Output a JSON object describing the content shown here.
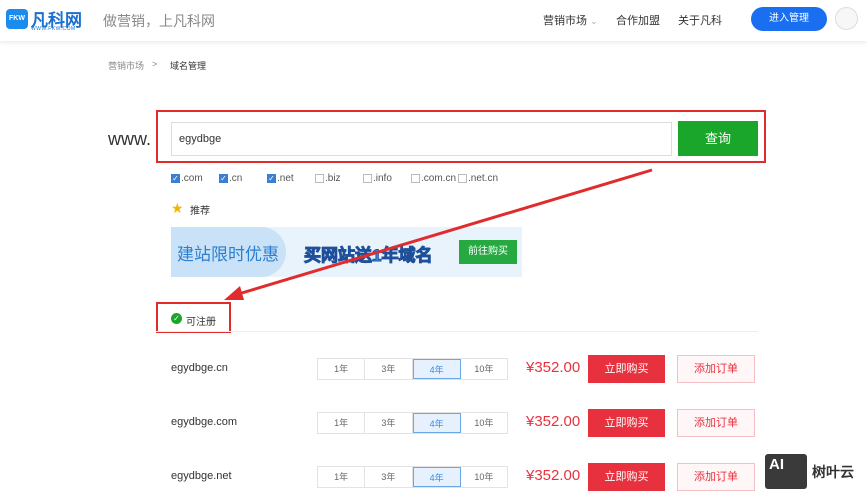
{
  "header": {
    "logo_badge": "FKW",
    "logo_name": "凡科网",
    "logo_url": "WWW.FKW.COM",
    "slogan": "做营销，上凡科网",
    "nav": [
      "营销市场",
      "合作加盟",
      "关于凡科"
    ],
    "nav_dropdown": "⌄",
    "enter_button": "进入管理"
  },
  "breadcrumb": {
    "parent": "营销市场",
    "sep": ">",
    "current": "域名管理"
  },
  "search": {
    "prefix": "www.",
    "value": "egydbge",
    "button": "查询"
  },
  "suffixes": [
    {
      "label": ".com",
      "checked": true
    },
    {
      "label": ".cn",
      "checked": true
    },
    {
      "label": ".net",
      "checked": true
    },
    {
      "label": ".biz",
      "checked": false
    },
    {
      "label": ".info",
      "checked": false
    },
    {
      "label": ".com.cn",
      "checked": false
    },
    {
      "label": ".net.cn",
      "checked": false
    }
  ],
  "recommend": {
    "label": "推荐"
  },
  "banner": {
    "left": "建站限时优惠",
    "middle": "买网站送1年域名",
    "button": "前往购买"
  },
  "status": {
    "label": "可注册"
  },
  "years": [
    "1年",
    "3年",
    "4年",
    "10年"
  ],
  "rows": [
    {
      "domain": "egydbge.cn",
      "selected_year": "4年",
      "price": "¥352.00",
      "buy": "立即购买",
      "add": "添加订单"
    },
    {
      "domain": "egydbge.com",
      "selected_year": "4年",
      "price": "¥352.00",
      "buy": "立即购买",
      "add": "添加订单"
    },
    {
      "domain": "egydbge.net",
      "selected_year": "4年",
      "price": "¥352.00",
      "buy": "立即购买",
      "add": "添加订单"
    }
  ],
  "watermark": {
    "badge": "AI",
    "text": "树叶云"
  },
  "colors": {
    "accent": "#1a6ff0",
    "green": "#1aa62a",
    "red": "#e8313e",
    "annotation": "#e02c2c"
  }
}
